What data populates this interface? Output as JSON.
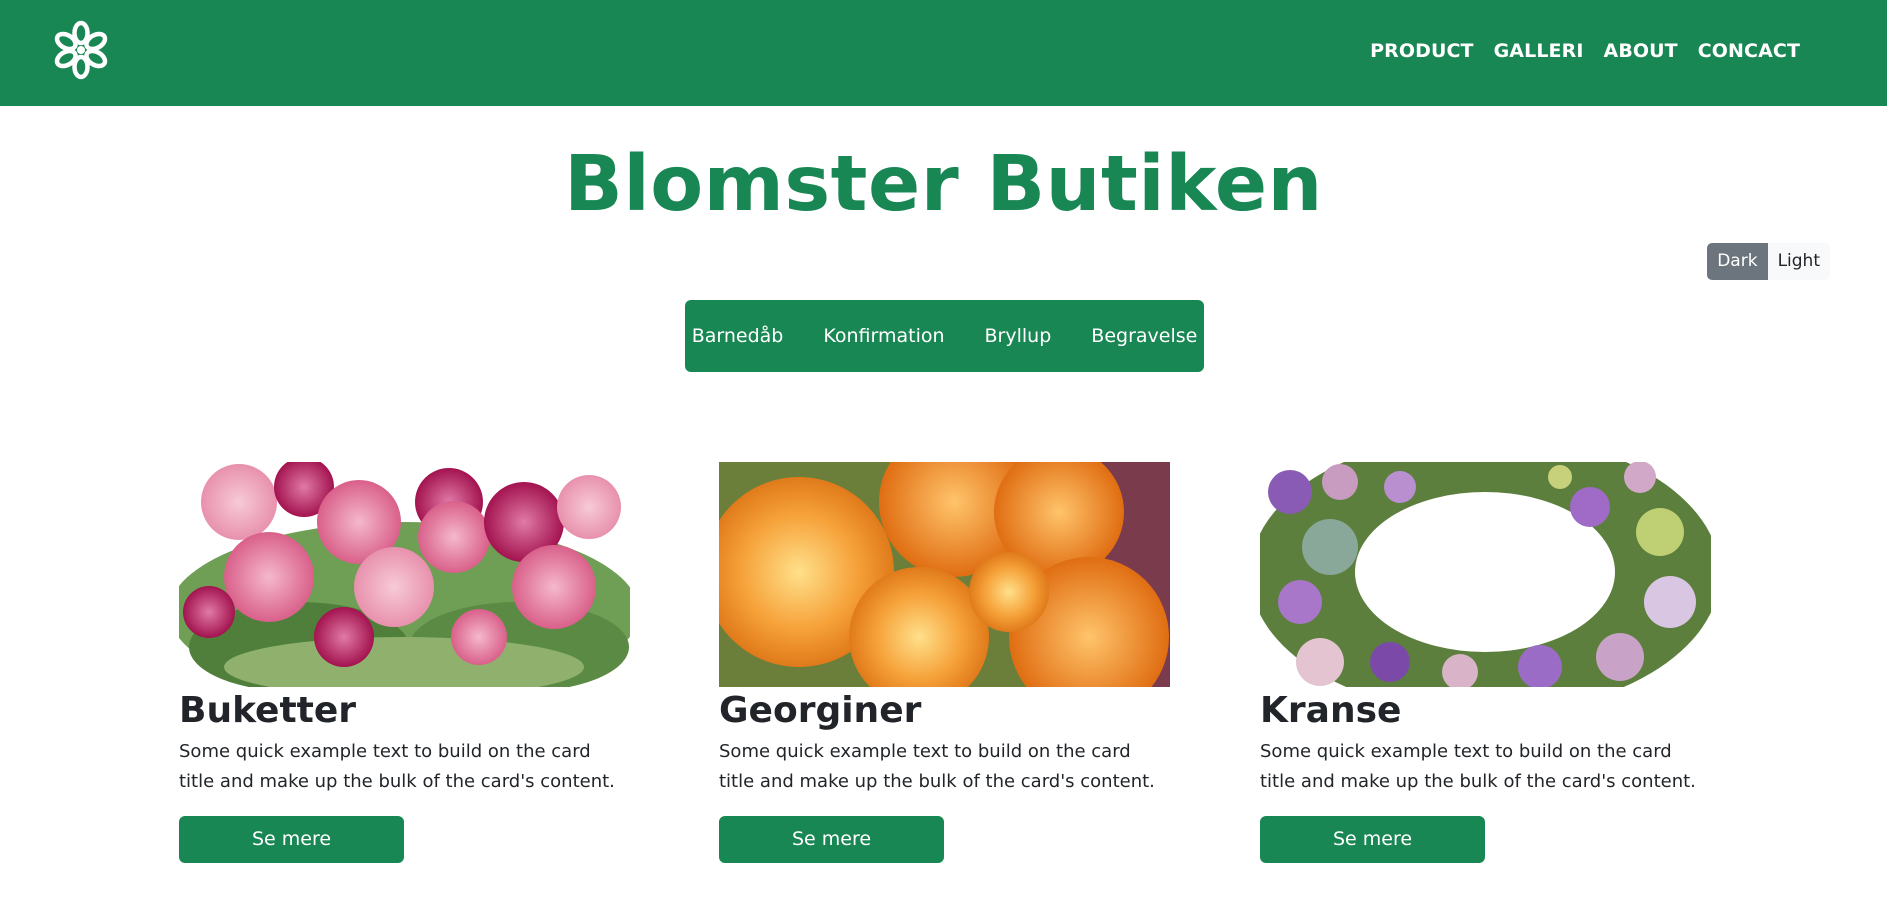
{
  "navbar": {
    "logo_icon": "flower-icon",
    "links": [
      {
        "label": "PRODUCT"
      },
      {
        "label": "GALLERI"
      },
      {
        "label": "ABOUT"
      },
      {
        "label": "CONCACT"
      }
    ]
  },
  "header": {
    "title": "Blomster Butiken"
  },
  "theme_toggle": {
    "dark_label": "Dark",
    "light_label": "Light",
    "selected": "Dark"
  },
  "categories": [
    {
      "label": "Barnedåb"
    },
    {
      "label": "Konfirmation"
    },
    {
      "label": "Bryllup"
    },
    {
      "label": "Begravelse"
    }
  ],
  "cards": [
    {
      "image": "pink-rose-bouquet-photo",
      "title": "Buketter",
      "text": "Some quick example text to build on the card title and make up the bulk of the card's content.",
      "button_label": "Se mere"
    },
    {
      "image": "orange-dahlia-photo",
      "title": "Georginer",
      "text": "Some quick example text to build on the card title and make up the bulk of the card's content.",
      "button_label": "Se mere"
    },
    {
      "image": "purple-flower-wreath-photo",
      "title": "Kranse",
      "text": "Some quick example text to build on the card title and make up the bulk of the card's content.",
      "button_label": "Se mere"
    }
  ],
  "colors": {
    "primary_green": "#198754",
    "toggle_dark": "#6c757d",
    "toggle_light": "#f8f9fa",
    "text": "#212529"
  }
}
